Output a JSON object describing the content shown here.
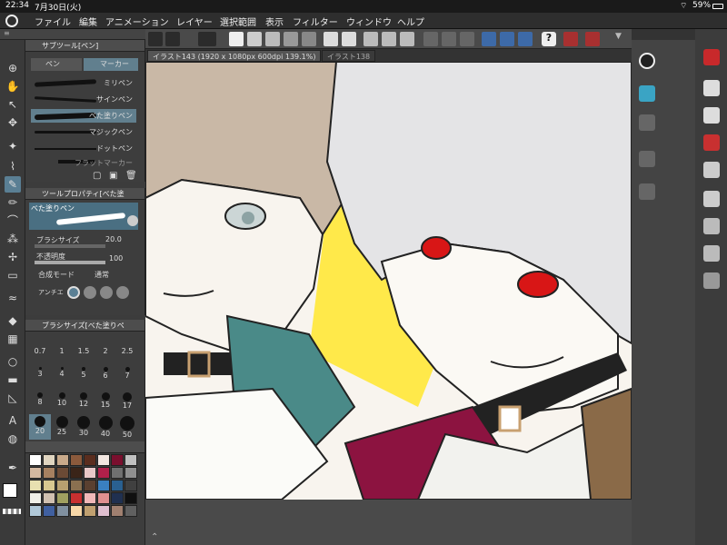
{
  "status_bar": {
    "time": "22:34",
    "date": "7月30日(火)",
    "battery": "59%"
  },
  "menu": [
    "ファイル",
    "編集",
    "アニメーション",
    "レイヤー",
    "選択範囲",
    "表示",
    "フィルター",
    "ウィンドウ",
    "ヘルプ"
  ],
  "sub_tool_panel": {
    "title": "サブツール[ペン]",
    "tabs": [
      "ペン",
      "マーカー"
    ],
    "brushes": [
      "ミリペン",
      "サインペン",
      "べた塗りペン",
      "マジックペン",
      "ドットペン",
      "フラットマーカー"
    ]
  },
  "tool_property": {
    "title": "ツールプロパティ[べた塗",
    "preview_label": "べた塗りペン",
    "brush_size_label": "ブラシサイズ",
    "brush_size_value": "20.0",
    "opacity_label": "不透明度",
    "opacity_value": "100",
    "blend_mode_label": "合成モード",
    "blend_mode_value": "通常",
    "antialias_label": "アンチエ"
  },
  "brush_size_panel": {
    "title": "ブラシサイズ[べた塗りペ",
    "sizes": [
      "0.7",
      "1",
      "1.5",
      "2",
      "2.5",
      "3",
      "4",
      "5",
      "6",
      "7",
      "8",
      "10",
      "12",
      "15",
      "17",
      "20",
      "25",
      "30",
      "40",
      "50"
    ]
  },
  "document_tabs": [
    {
      "label": "イラスト143 (1920 x 1080px 600dpi 139.1%)"
    },
    {
      "label": "イラスト138"
    }
  ],
  "colors": {
    "palette": [
      "#ffffff",
      "#e0d5c0",
      "#c8a98a",
      "#8b5a3c",
      "#5a2d1e",
      "#f2e6e0",
      "#7a0f2e",
      "#c0c0c0",
      "#d4b8a0",
      "#a68060",
      "#6b4a35",
      "#3a2418",
      "#e8c8c8",
      "#b0204a",
      "#707070",
      "#909090",
      "#e8e0b0",
      "#d8c890",
      "#b8a070",
      "#8a7050",
      "#5a4030",
      "#3a80c0",
      "#2a6090",
      "#404040",
      "#f0f0e8",
      "#d0c0b0",
      "#a0a060",
      "#c83030",
      "#f0b8b8",
      "#e09090",
      "#203050",
      "#101010",
      "#b0c8d8",
      "#4060a0",
      "#8090a0",
      "#f8d8a8",
      "#c0a070",
      "#e0c0d0",
      "#a08070",
      "#606060"
    ],
    "main_color": "#ffffff",
    "sub_color": "#2a6faa",
    "canvas_yellow": "#ffe94a",
    "hair_gray": "#e4e4e6",
    "hair_brown": "#c9b8a6",
    "eye_red": "#d81616",
    "teal_coat": "#4a8a88",
    "crimson_coat": "#8c1340",
    "ui_accent": "#5a7f94"
  }
}
